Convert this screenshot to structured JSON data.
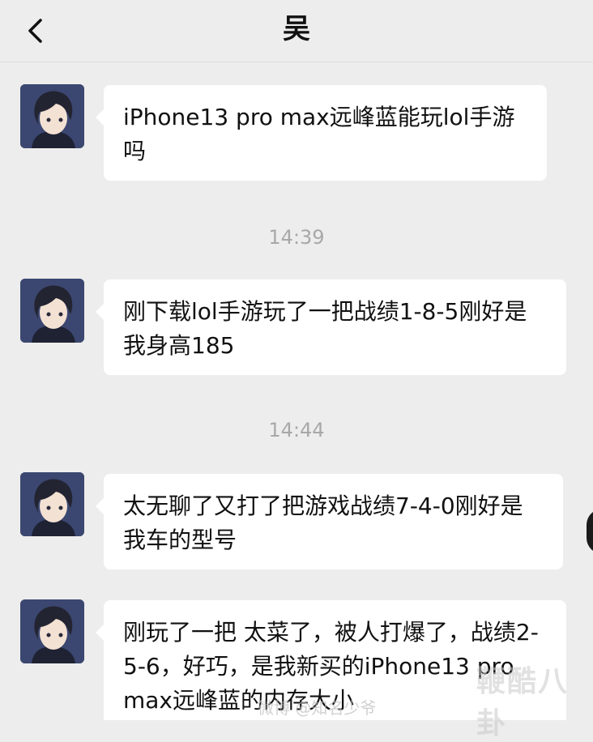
{
  "header": {
    "back_icon": "chevron-left-icon",
    "title": "吴"
  },
  "messages": [
    {
      "type": "text",
      "text": "iPhone13 pro max远峰蓝能玩lol手游吗"
    },
    {
      "type": "time",
      "text": "14:39"
    },
    {
      "type": "text",
      "text": "刚下载lol手游玩了一把战绩1-8-5刚好是我身高185"
    },
    {
      "type": "time",
      "text": "14:44"
    },
    {
      "type": "text",
      "text": "太无聊了又打了把游戏战绩7-4-0刚好是我车的型号"
    },
    {
      "type": "text",
      "text": "刚玩了一把 太菜了，被人打爆了，战绩2-5-6，好巧，是我新买的iPhone13 pro max远峰蓝的内存大小"
    }
  ],
  "watermarks": {
    "brand": "鞭酷八卦",
    "weibo": "微博 @知名少爷"
  }
}
